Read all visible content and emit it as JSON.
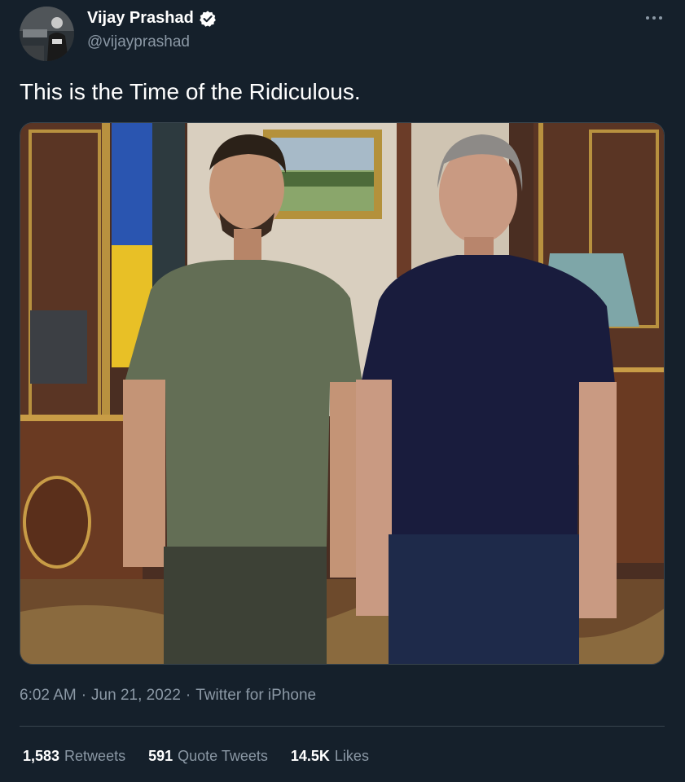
{
  "author": {
    "display_name": "Vijay Prashad",
    "handle": "@vijayprashad",
    "verified": true
  },
  "tweet": {
    "text": "This is the Time of the Ridiculous.",
    "time": "6:02 AM",
    "date": "Jun 21, 2022",
    "source": "Twitter for iPhone",
    "separator": "·"
  },
  "stats": {
    "retweets_count": "1,583",
    "retweets_label": "Retweets",
    "quotes_count": "591",
    "quotes_label": "Quote Tweets",
    "likes_count": "14.5K",
    "likes_label": "Likes"
  },
  "colors": {
    "background": "#15202b",
    "secondary_text": "#8b98a5",
    "verified_badge": "#ffffff",
    "divider": "#38444d"
  },
  "icons": {
    "verified": "verified-badge-icon",
    "more": "more-options-icon"
  }
}
